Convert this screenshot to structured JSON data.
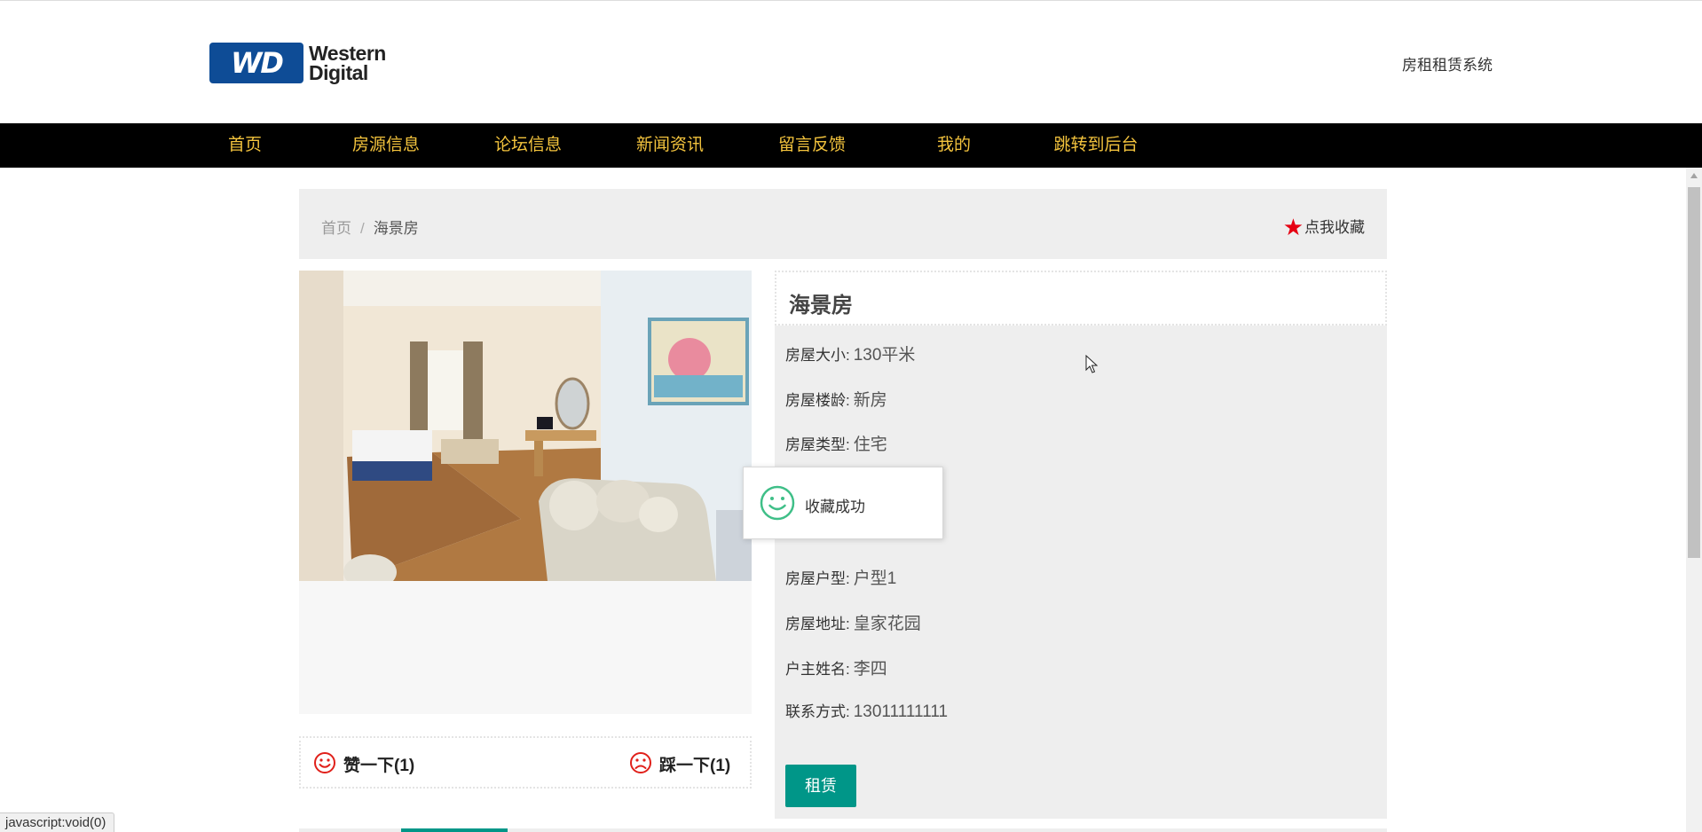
{
  "header": {
    "logo_badge": "WD",
    "logo_line1": "Western",
    "logo_line2": "Digital",
    "site_title": "房租租赁系统"
  },
  "nav": {
    "items": [
      "首页",
      "房源信息",
      "论坛信息",
      "新闻资讯",
      "留言反馈",
      "我的",
      "跳转到后台"
    ]
  },
  "breadcrumb": {
    "home": "首页",
    "separator": "/",
    "current": "海景房"
  },
  "favorite": {
    "icon": "star-icon",
    "label": "点我收藏"
  },
  "vote": {
    "like_label": "赞一下(1)",
    "dislike_label": "踩一下(1)"
  },
  "house": {
    "title": "海景房",
    "fields": [
      {
        "label": "房屋大小:",
        "value": "130平米"
      },
      {
        "label": "房屋楼龄:",
        "value": "新房"
      },
      {
        "label": "房屋类型:",
        "value": "住宅"
      },
      {
        "label": "房屋户型:",
        "value": "户型1"
      },
      {
        "label": "房屋地址:",
        "value": "皇家花园"
      },
      {
        "label": "户主姓名:",
        "value": "李四"
      },
      {
        "label": "联系方式:",
        "value": "13011111111"
      }
    ],
    "rent_button": "租赁"
  },
  "toast": {
    "icon": "smile-icon",
    "message": "收藏成功"
  },
  "status_bar": "javascript:void(0)",
  "colors": {
    "nav_bg": "#000000",
    "nav_text": "#f3c33d",
    "accent": "#009688",
    "star": "#e60012",
    "panel_bg": "#eeeeee"
  }
}
